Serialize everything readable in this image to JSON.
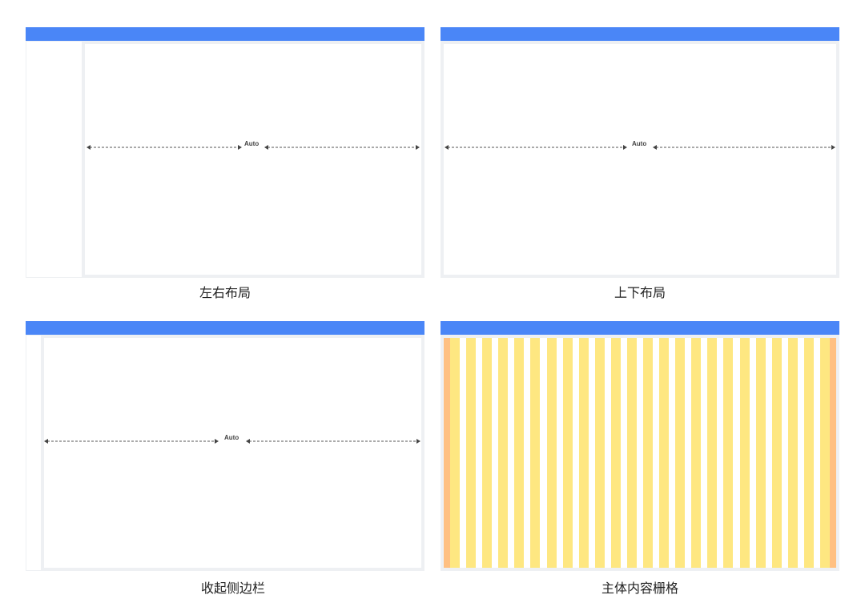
{
  "panels": {
    "left_right": {
      "caption": "左右布局",
      "auto_label": "Auto"
    },
    "top_bottom": {
      "caption": "上下布局",
      "auto_label": "Auto"
    },
    "collapsed_sidebar": {
      "caption": "收起侧边栏",
      "auto_label": "Auto"
    },
    "content_grid": {
      "caption": "主体内容栅格",
      "column_count": 24
    }
  },
  "colors": {
    "header_blue": "#4a86f7",
    "frame_gray": "#eef0f3",
    "column_yellow": "#fee781",
    "gutter_margin_orange": "#ffc082"
  }
}
